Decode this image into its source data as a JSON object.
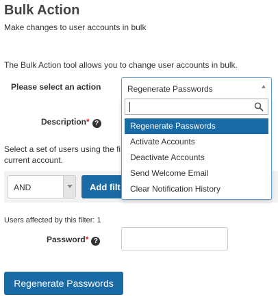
{
  "header": {
    "title": "Bulk Action",
    "subtitle": "Make changes to user accounts in bulk"
  },
  "intro": "The Bulk Action tool allows you to change user accounts in bulk.",
  "form": {
    "action_label": "Please select an action",
    "action_selected": "Regenerate Passwords",
    "description_label": "Description",
    "required_marker": "*",
    "help_glyph": "?",
    "filter_text": "Select a set of users using the fi... current account.",
    "filter_text_line1": "Select a set of users using the fi",
    "filter_text_line2": "current account.",
    "operator_value": "AND",
    "add_filter_label": "Add filt",
    "users_affected": "Users affected by this filter: 1",
    "password_label": "Password",
    "password_value": "",
    "submit_label": "Regenerate Passwords"
  },
  "dropdown": {
    "search_value": "",
    "options": [
      {
        "label": "Regenerate Passwords",
        "selected": true
      },
      {
        "label": "Activate Accounts",
        "selected": false
      },
      {
        "label": "Deactivate Accounts",
        "selected": false
      },
      {
        "label": "Send Welcome Email",
        "selected": false
      },
      {
        "label": "Clear Notification History",
        "selected": false
      }
    ]
  },
  "colors": {
    "primary": "#1a6aa6",
    "focus_border": "#5b9bd5",
    "required": "#cc2222"
  },
  "icons": {
    "help": "help-icon",
    "search": "search-icon",
    "dropdown_caret": "chevron-up-icon",
    "select_caret": "chevron-down-icon"
  }
}
